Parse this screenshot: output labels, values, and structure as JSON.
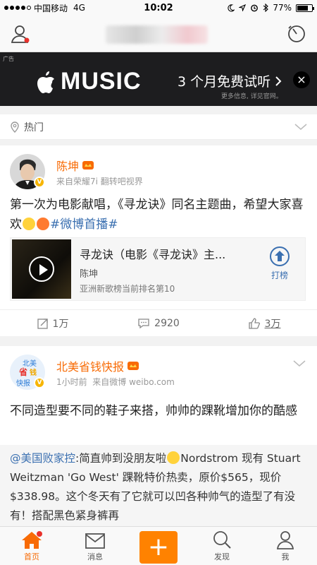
{
  "status_bar": {
    "carrier": "中国移动",
    "network": "4G",
    "time": "10:02",
    "battery": "77%"
  },
  "nav": {
    "user_icon": "user-icon",
    "radar_icon": "radar-icon"
  },
  "ad": {
    "tag": "广告",
    "brand": "MUSIC",
    "cta": "3 个月免费试听",
    "sub": "更多信息, 详见官网。",
    "close": "×"
  },
  "hot": {
    "label": "热门"
  },
  "post1": {
    "author": "陈坤",
    "source": "来自荣耀7i 翻转吧视界",
    "text": "第一次为电影献唱，《寻龙诀》同名主题曲，希望大家喜欢",
    "topic": "#微博首播#",
    "media": {
      "title": "寻龙诀（电影《寻龙诀》主...",
      "artist": "陈坤",
      "rank": "亚洲新歌榜当前排名第10",
      "chart_button": "打榜"
    },
    "reposts": "1万",
    "comments": "2920",
    "likes": "3万"
  },
  "post2": {
    "author": "北美省钱快报",
    "avatar_text": [
      "北美",
      "省",
      "钱",
      "快报"
    ],
    "time": "1小时前",
    "source": "来自微博 weibo.com",
    "text": "不同造型要不同的鞋子来搭，帅帅的踝靴增加你的酷感",
    "repost_mention": "@美国败家控",
    "repost_text": ":简直帅到没朋友啦",
    "repost_body": "Nordstrom 现有 Stuart Weitzman 'Go West' 踝靴特价热卖，原价$565，现价$338.98。这个冬天有了它就可以凹各种帅气的造型了有没有！搭配黑色紧身裤再"
  },
  "tabs": [
    {
      "label": "首页",
      "icon": "home-icon"
    },
    {
      "label": "消息",
      "icon": "message-icon"
    },
    {
      "label": "",
      "icon": "compose-icon"
    },
    {
      "label": "发现",
      "icon": "discover-icon"
    },
    {
      "label": "我",
      "icon": "profile-icon"
    }
  ],
  "colors": {
    "accent": "#f86b05",
    "link": "#3a6fb0",
    "compose": "#ff8200"
  }
}
